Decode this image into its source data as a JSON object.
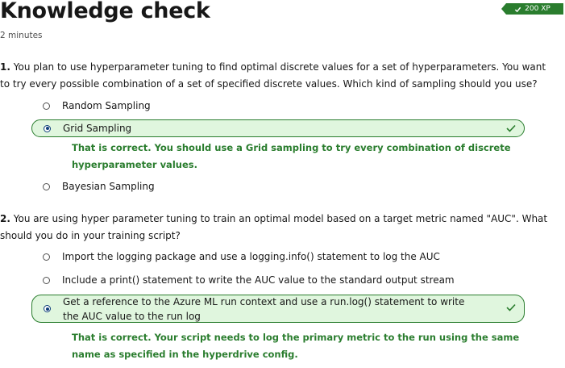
{
  "header": {
    "title": "Knowledge check",
    "duration": "2 minutes",
    "xp_badge": "200 XP"
  },
  "questions": [
    {
      "number": "1.",
      "text": "You plan to use hyperparameter tuning to find optimal discrete values for a set of hyperparameters. You want to try every possible combination of a set of specified discrete values. Which kind of sampling should you use?",
      "options": [
        "Random Sampling",
        "Grid Sampling",
        "Bayesian Sampling"
      ],
      "selected_index": 1,
      "feedback": "That is correct. You should use a Grid sampling to try every combination of discrete hyperparameter values."
    },
    {
      "number": "2.",
      "text": "You are using hyper parameter tuning to train an optimal model based on a target metric named \"AUC\". What should you do in your training script?",
      "options": [
        "Import the logging package and use a logging.info() statement to log the AUC",
        "Include a print() statement to write the AUC value to the standard output stream",
        "Get a reference to the Azure ML run context and use a run.log() statement to write the AUC value to the run log"
      ],
      "selected_index": 2,
      "feedback": "That is correct. Your script needs to log the primary metric to the run using the same name as specified in the hyperdrive config."
    }
  ],
  "colors": {
    "success_green": "#2a7d2e",
    "selected_bg": "#e0f6de",
    "radio_selected": "#0f3e7a"
  },
  "icons": {
    "badge": "checkmark-icon",
    "correct": "checkmark-icon"
  }
}
